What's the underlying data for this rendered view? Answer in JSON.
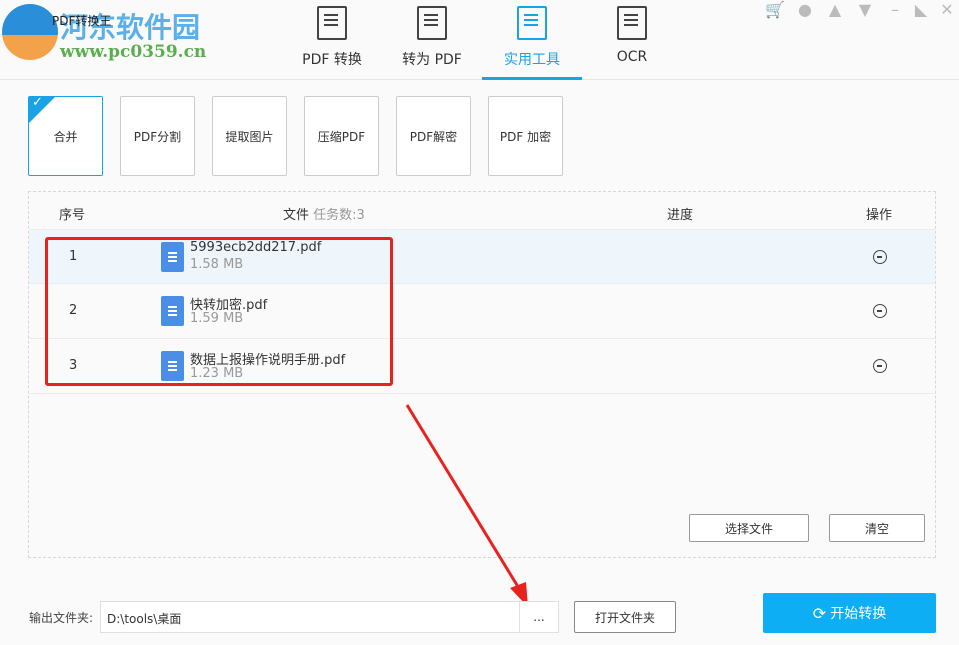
{
  "app": {
    "title": "PDF转换王",
    "watermark_name": "河东软件园",
    "watermark_url": "www.pc0359.cn"
  },
  "tabs": [
    {
      "label": "PDF 转换"
    },
    {
      "label": "转为 PDF"
    },
    {
      "label": "实用工具"
    },
    {
      "label": "OCR"
    }
  ],
  "tools": [
    {
      "label": "合并"
    },
    {
      "label": "PDF分割"
    },
    {
      "label": "提取图片"
    },
    {
      "label": "压缩PDF"
    },
    {
      "label": "PDF解密"
    },
    {
      "label": "PDF 加密"
    }
  ],
  "table": {
    "col_index": "序号",
    "col_file": "文件",
    "task_count": "任务数:3",
    "col_progress": "进度",
    "col_action": "操作",
    "rows": [
      {
        "index": "1",
        "name": "5993ecb2dd217.pdf",
        "size": "1.58 MB"
      },
      {
        "index": "2",
        "name": "快转加密.pdf",
        "size": "1.59 MB"
      },
      {
        "index": "3",
        "name": "数据上报操作说明手册.pdf",
        "size": "1.23 MB"
      }
    ]
  },
  "buttons": {
    "select_files": "选择文件",
    "clear": "清空",
    "browse": "...",
    "open_folder": "打开文件夹",
    "start": "开始转换"
  },
  "output": {
    "label": "输出文件夹:",
    "path": "D:\\tools\\桌面"
  }
}
